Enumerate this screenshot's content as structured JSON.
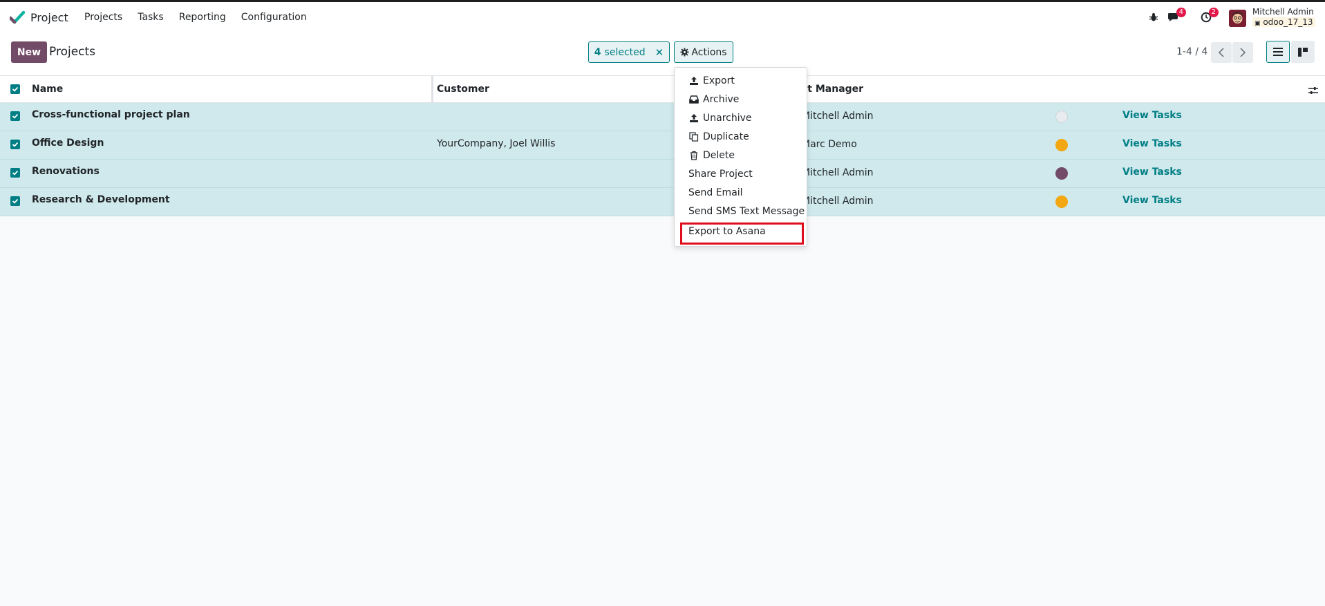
{
  "navbar": {
    "app_name": "Project",
    "menu": [
      "Projects",
      "Tasks",
      "Reporting",
      "Configuration"
    ],
    "messages_count": "4",
    "activities_count": "2",
    "user_name": "Mitchell Admin",
    "database": "odoo_17_13"
  },
  "control": {
    "new_label": "New",
    "breadcrumb": "Projects",
    "selected_count": "4",
    "selected_label": "selected",
    "actions_label": "Actions",
    "pager": "1-4 / 4"
  },
  "table": {
    "headers": {
      "name": "Name",
      "customer": "Customer",
      "manager": "ct Manager"
    },
    "rows": [
      {
        "name": "Cross-functional project plan",
        "customer": "",
        "manager": "Mitchell Admin",
        "status_color": "#e9ecef",
        "action": "View Tasks"
      },
      {
        "name": "Office Design",
        "customer": "YourCompany, Joel Willis",
        "manager": "Marc Demo",
        "status_color": "#f3a712",
        "action": "View Tasks"
      },
      {
        "name": "Renovations",
        "customer": "",
        "manager": "Mitchell Admin",
        "status_color": "#714b67",
        "action": "View Tasks"
      },
      {
        "name": "Research & Development",
        "customer": "",
        "manager": "Mitchell Admin",
        "status_color": "#f3a712",
        "action": "View Tasks"
      }
    ]
  },
  "actions_menu": {
    "items": [
      {
        "label": "Export",
        "icon": "upload-icon"
      },
      {
        "label": "Archive",
        "icon": "inbox-icon"
      },
      {
        "label": "Unarchive",
        "icon": "upload-icon"
      },
      {
        "label": "Duplicate",
        "icon": "copy-icon"
      },
      {
        "label": "Delete",
        "icon": "trash-icon"
      },
      {
        "label": "Share Project",
        "icon": ""
      },
      {
        "label": "Send Email",
        "icon": ""
      },
      {
        "label": "Send SMS Text Message",
        "icon": ""
      },
      {
        "label": "Export to Asana",
        "icon": ""
      }
    ]
  },
  "colors": {
    "brand": "#714b67",
    "accent": "#017e84",
    "selected_row": "#cfe9ec",
    "highlight": "#e00e1c"
  }
}
